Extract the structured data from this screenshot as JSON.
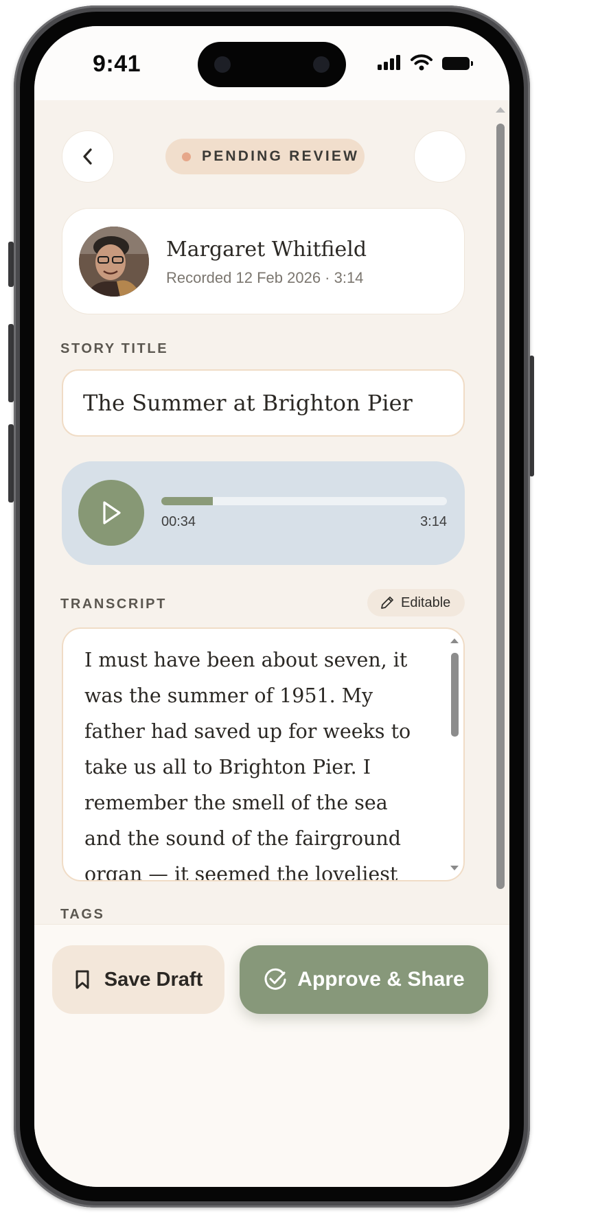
{
  "status_bar": {
    "time": "9:41"
  },
  "header": {
    "status": "PENDING REVIEW"
  },
  "narrator": {
    "name": "Margaret Whitfield",
    "meta": "Recorded 12 Feb 2026 · 3:14"
  },
  "story_title": {
    "label": "STORY TITLE",
    "value": "The Summer at Brighton Pier"
  },
  "audio": {
    "current_time": "00:34",
    "total_time": "3:14",
    "progress": 0.18
  },
  "transcript": {
    "label": "TRANSCRIPT",
    "edit_label": "Editable",
    "text": "I must have been about seven, it was the summer of 1951. My father had saved up for weeks to take us all to Brighton Pier. I remember the smell of the sea and the sound of the fairground organ — it seemed the loveliest thing in the world. My"
  },
  "tags": {
    "label": "TAGS"
  },
  "actions": {
    "save_draft": "Save Draft",
    "approve_share": "Approve & Share"
  },
  "colors": {
    "accent_green": "#879875",
    "pending_pill": "#f1decc",
    "pending_dot": "#e6a78a",
    "audio_bg": "#d7e0e8",
    "background": "#f7f2ec"
  }
}
